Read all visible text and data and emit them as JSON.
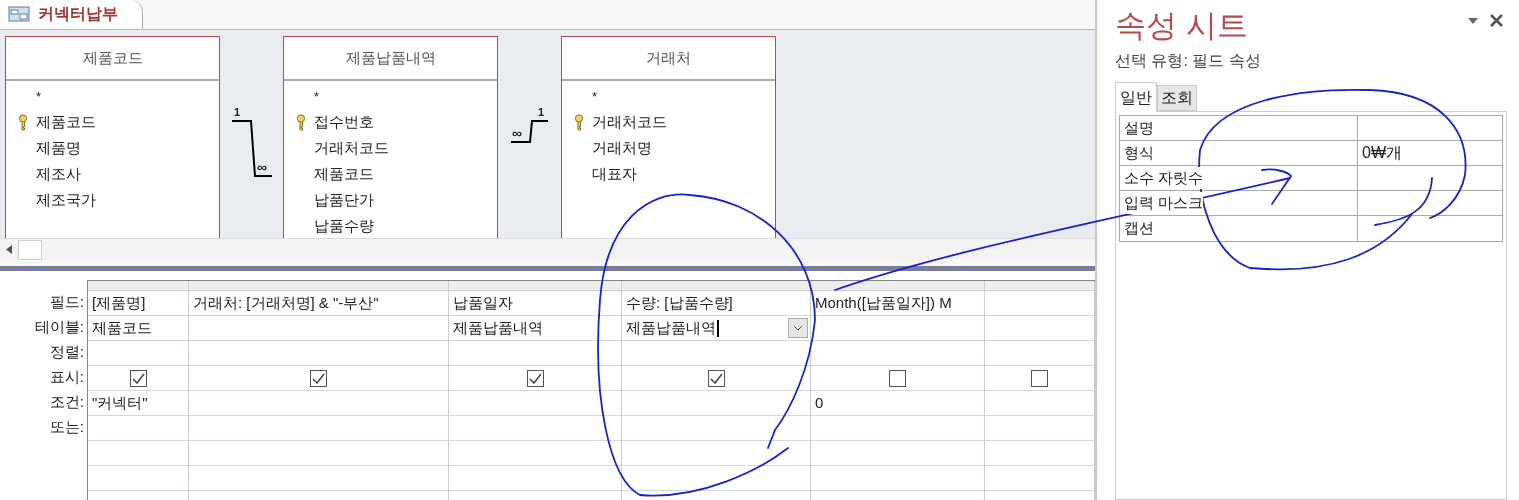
{
  "document_tab": {
    "title": "커넥터납부",
    "selected": true
  },
  "tables": [
    {
      "title": "제품코드",
      "fields": [
        {
          "name": "*",
          "primary_key": false
        },
        {
          "name": "제품코드",
          "primary_key": true
        },
        {
          "name": "제품명",
          "primary_key": false
        },
        {
          "name": "제조사",
          "primary_key": false
        },
        {
          "name": "제조국가",
          "primary_key": false
        }
      ]
    },
    {
      "title": "제품납품내역",
      "fields": [
        {
          "name": "*",
          "primary_key": false
        },
        {
          "name": "접수번호",
          "primary_key": true
        },
        {
          "name": "거래처코드",
          "primary_key": false
        },
        {
          "name": "제품코드",
          "primary_key": false
        },
        {
          "name": "납품단가",
          "primary_key": false
        },
        {
          "name": "납품수량",
          "primary_key": false
        }
      ]
    },
    {
      "title": "거래처",
      "fields": [
        {
          "name": "*",
          "primary_key": false
        },
        {
          "name": "거래처코드",
          "primary_key": true
        },
        {
          "name": "거래처명",
          "primary_key": false
        },
        {
          "name": "대표자",
          "primary_key": false
        }
      ]
    }
  ],
  "relationships": [
    {
      "one": "1",
      "many": "∞"
    },
    {
      "one": "1",
      "many": "∞"
    }
  ],
  "grid": {
    "row_labels": [
      "필드:",
      "테이블:",
      "정렬:",
      "표시:",
      "조건:",
      "또는:"
    ],
    "columns": [
      {
        "field": "[제품명]",
        "table": "제품코드",
        "show": true,
        "criteria": "\"커넥터\"",
        "selected": false
      },
      {
        "field": "거래처: [거래처명] & \"-부산\"",
        "show": true,
        "selected": false
      },
      {
        "field": "납품일자",
        "table": "제품납품내역",
        "show": true,
        "selected": false
      },
      {
        "field": "수량: [납품수량]",
        "table": "제품납품내역",
        "show": true,
        "selected": true
      },
      {
        "field": "Month([납품일자]) M",
        "show": false,
        "criteria": "0",
        "selected": false
      },
      {
        "show": false,
        "selected": false
      }
    ]
  },
  "property_sheet": {
    "title": "속성 시트",
    "selection_type": "선택 유형: 필드 속성",
    "tabs": [
      {
        "label": "일반",
        "selected": true
      },
      {
        "label": "조회",
        "selected": false
      }
    ],
    "properties": [
      {
        "name": "설명"
      },
      {
        "name": "형식",
        "value": "0₩개"
      },
      {
        "name": "소수 자릿수"
      },
      {
        "name": "입력 마스크"
      },
      {
        "name": "캡션"
      }
    ]
  }
}
